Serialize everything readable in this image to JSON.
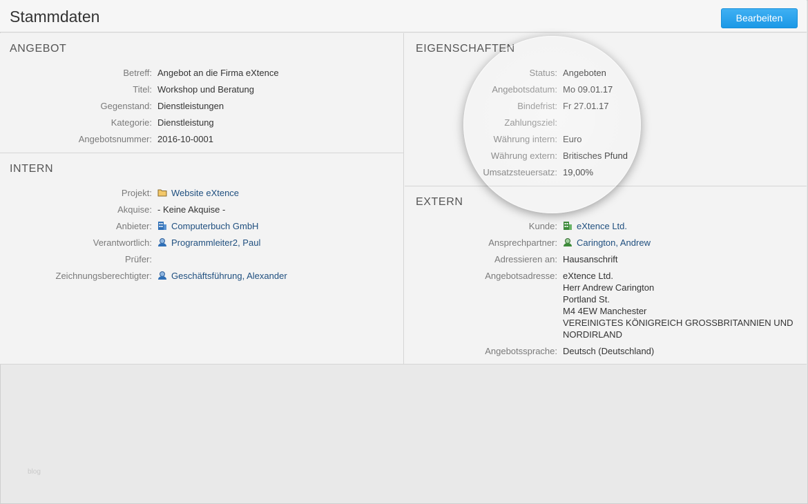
{
  "header": {
    "title": "Stammdaten",
    "edit_button": "Bearbeiten"
  },
  "angebot": {
    "title": "ANGEBOT",
    "rows": [
      {
        "label": "Betreff:",
        "value": "Angebot an die Firma eXtence"
      },
      {
        "label": "Titel:",
        "value": "Workshop und Beratung"
      },
      {
        "label": "Gegenstand:",
        "value": "Dienstleistungen"
      },
      {
        "label": "Kategorie:",
        "value": "Dienstleistung"
      },
      {
        "label": "Angebotsnummer:",
        "value": "2016-10-0001"
      }
    ]
  },
  "intern": {
    "title": "INTERN",
    "rows": [
      {
        "label": "Projekt:",
        "value": "Website eXtence",
        "icon": "folder-icon"
      },
      {
        "label": "Akquise:",
        "value": "- Keine Akquise -"
      },
      {
        "label": "Anbieter:",
        "value": "Computerbuch GmbH",
        "icon": "company-icon"
      },
      {
        "label": "Verantwortlich:",
        "value": "Programmleiter2, Paul",
        "icon": "person-icon"
      },
      {
        "label": "Prüfer:",
        "value": ""
      },
      {
        "label": "Zeichnungsberechtigter:",
        "value": "Geschäftsführung, Alexander",
        "icon": "person-icon"
      }
    ]
  },
  "eigenschaften": {
    "title": "EIGENSCHAFTEN",
    "rows": [
      {
        "label": "Status:",
        "value": "Angeboten"
      },
      {
        "label": "Angebotsdatum:",
        "value": "Mo 09.01.17"
      },
      {
        "label": "Bindefrist:",
        "value": "Fr 27.01.17"
      },
      {
        "label": "Zahlungsziel:",
        "value": ""
      },
      {
        "label": "Währung intern:",
        "value": "Euro"
      },
      {
        "label": "Währung extern:",
        "value": "Britisches Pfund"
      },
      {
        "label": "Umsatzsteuersatz:",
        "value": "19,00%"
      }
    ]
  },
  "extern": {
    "title": "EXTERN",
    "rows": [
      {
        "label": "Kunde:",
        "value": "eXtence Ltd.",
        "icon": "customer-company-icon"
      },
      {
        "label": "Ansprechpartner:",
        "value": "Carington, Andrew",
        "icon": "contact-person-icon"
      },
      {
        "label": "Adressieren an:",
        "value": "Hausanschrift"
      },
      {
        "label": "Angebotsadresse:",
        "lines": [
          "eXtence Ltd.",
          "Herr Andrew Carington",
          "Portland St.",
          "M4 4EW Manchester",
          "VEREINIGTES KÖNIGREICH GROSSBRITANNIEN UND",
          "NORDIRLAND"
        ]
      },
      {
        "label": "Angebotssprache:",
        "value": "Deutsch (Deutschland)"
      }
    ]
  },
  "watermark": "blog",
  "colors": {
    "accent": "#1b98e6",
    "link": "#1f4f7f",
    "company_icon": "#2f6fb6",
    "customer_icon": "#3d8a3a"
  }
}
